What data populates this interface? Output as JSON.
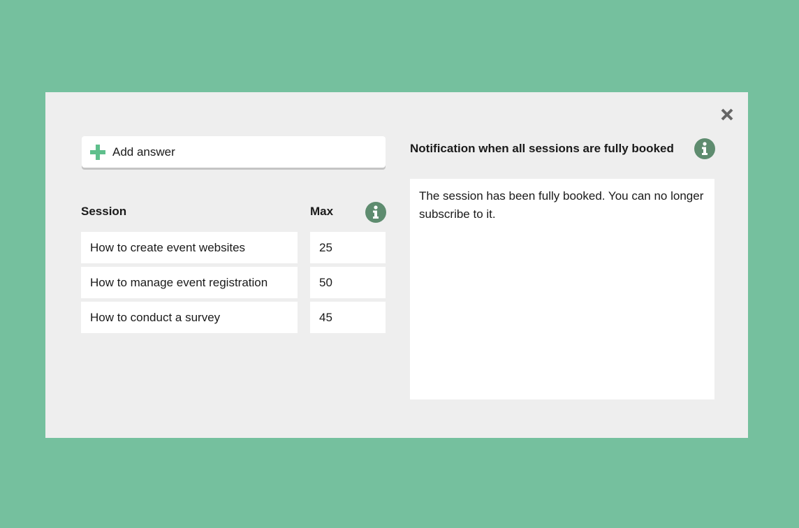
{
  "modal": {
    "close_icon": "close-x-icon",
    "add_answer": {
      "label": "Add answer",
      "icon": "plus-icon"
    },
    "table": {
      "headers": {
        "session": "Session",
        "max": "Max"
      },
      "rows": [
        {
          "session": "How to create event websites",
          "max": "25"
        },
        {
          "session": "How to manage event registration",
          "max": "50"
        },
        {
          "session": "How to conduct a survey",
          "max": "45"
        }
      ]
    },
    "notification": {
      "title": "Notification when all sessions are fully booked",
      "message": "The session has been fully booked. You can no longer subscribe to it."
    }
  },
  "colors": {
    "background": "#75c09e",
    "modal": "#eeeeee",
    "accent_plus": "#5fbf8c",
    "info_icon": "#5e8c6f",
    "close_icon": "#666666"
  }
}
